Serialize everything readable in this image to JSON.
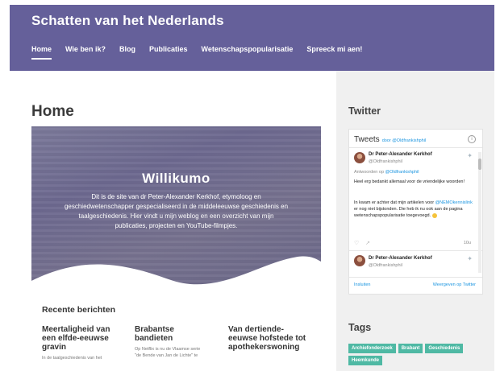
{
  "site": {
    "title": "Schatten van het Nederlands"
  },
  "nav": [
    {
      "label": "Home",
      "active": true
    },
    {
      "label": "Wie ben ik?"
    },
    {
      "label": "Blog"
    },
    {
      "label": "Publicaties"
    },
    {
      "label": "Wetenschapspopularisatie"
    },
    {
      "label": "Spreeck mi aen!"
    }
  ],
  "main": {
    "page_title": "Home",
    "hero": {
      "heading": "Willikumo",
      "text": "Dit is de site van dr Peter-Alexander Kerkhof, etymoloog en geschiedwetenschapper gespecialiseerd in de middeleeuwse geschiedenis en taalgeschiedenis. Hier vindt u mijn weblog en een overzicht van mijn publicaties, projecten en YouTube-filmpjes."
    },
    "recent_title": "Recente berichten",
    "posts": [
      {
        "title": "Meertaligheid van een elfde-eeuwse gravin",
        "excerpt": "In de taalgeschiedenis van het"
      },
      {
        "title": "Brabantse bandieten",
        "excerpt": "Op Netflix is nu de Vlaamse serie \"de Bende van Jan de Lichte\" te"
      },
      {
        "title": "Van dertiende-eeuwse hofstede tot apothekerswoning",
        "excerpt": ""
      }
    ]
  },
  "sidebar": {
    "twitter_title": "Twitter",
    "tweets_header": "Tweets",
    "tweets_by": "door @Oldfrankishphil",
    "tweet1": {
      "name": "Dr Peter-Alexander Kerkhof",
      "handle": "@Oldfrankishphil",
      "reply_prefix": "Antwoorden op",
      "reply_to": "@Oldfrankishphil",
      "text1": "Heel erg bedankt allemaal voor de vriendelijke woorden!",
      "text2_a": "In kwam er achter dat mijn artikelen voor",
      "text2_link": "@NEMOkennislink",
      "text2_b": "er nog niet bijstonden. Die heb ik nu ook aan de pagina wetenschapspopularisatie toegevoegd.",
      "time": "10u"
    },
    "tweet2": {
      "name": "Dr Peter-Alexander Kerkhof",
      "handle": "@Oldfrankishphil"
    },
    "embed_label": "Insluiten",
    "view_label": "Weergeven op Twitter",
    "tags_title": "Tags",
    "tags": [
      "Archiefonderzoek",
      "Brabant",
      "Geschiedenis",
      "Heemkunde"
    ]
  }
}
